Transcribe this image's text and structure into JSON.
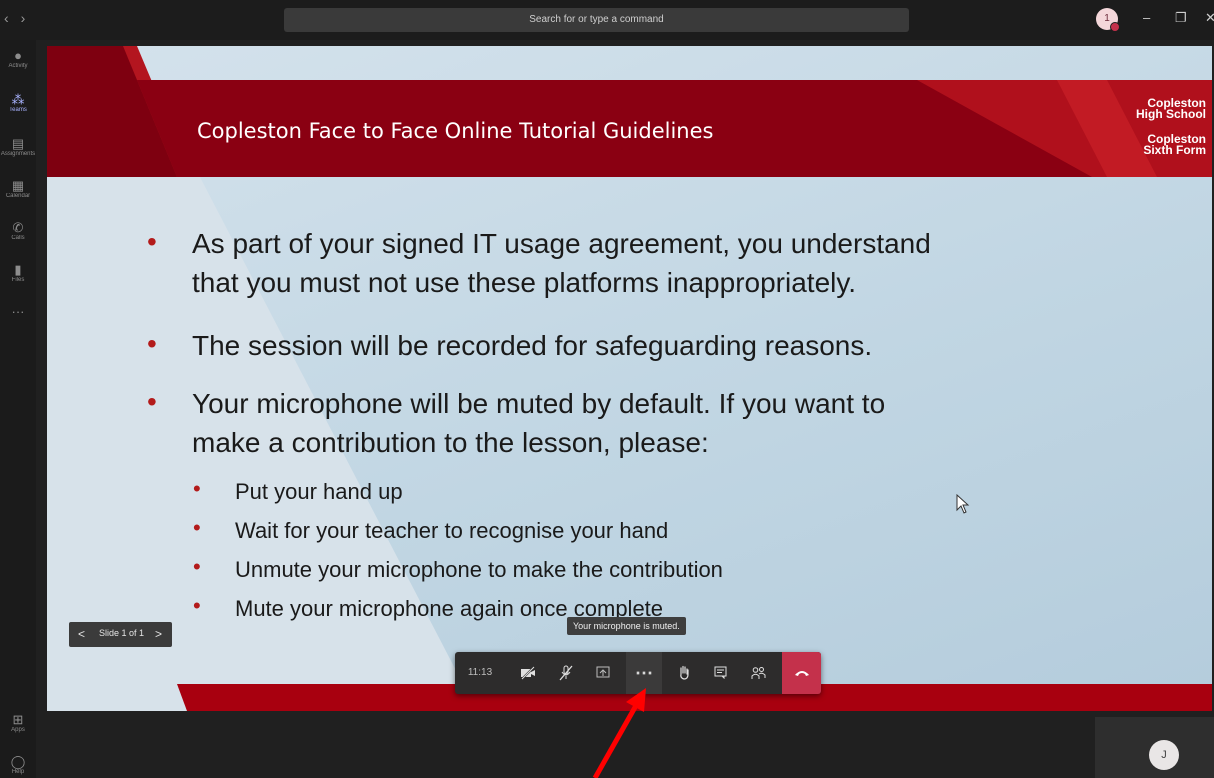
{
  "titlebar": {
    "search_placeholder": "Search for or type a command",
    "avatar_initial": "1",
    "minimize": "–",
    "maximize": "❐",
    "close": "✕",
    "back": "‹",
    "forward": "›"
  },
  "rail": {
    "items": [
      {
        "label": "Activity",
        "icon": "bell-icon",
        "glyph": "🔔"
      },
      {
        "label": "Teams",
        "icon": "teams-icon",
        "glyph": "⁂"
      },
      {
        "label": "Assignments",
        "icon": "assignments-icon",
        "glyph": "▤"
      },
      {
        "label": "Calendar",
        "icon": "calendar-icon",
        "glyph": "▦"
      },
      {
        "label": "Calls",
        "icon": "phone-icon",
        "glyph": "✆"
      },
      {
        "label": "Files",
        "icon": "file-icon",
        "glyph": "▮"
      },
      {
        "label": "",
        "icon": "more-icon",
        "glyph": "···"
      }
    ],
    "bottom": [
      {
        "label": "Apps",
        "icon": "apps-icon",
        "glyph": "⊞"
      },
      {
        "label": "Help",
        "icon": "help-icon",
        "glyph": "?"
      }
    ]
  },
  "slide": {
    "title": "Copleston Face to Face Online Tutorial Guidelines",
    "logo_line1": "Copleston",
    "logo_line2": "High School",
    "logo_line3": "Copleston",
    "logo_line4": "Sixth Form",
    "bullets": [
      "As part of your signed IT usage agreement, you understand",
      "that you must not use these platforms inappropriately.",
      "The session will be recorded for safeguarding reasons.",
      "Your microphone will be muted by default. If you want to",
      "make a contribution to the lesson, please:"
    ],
    "sub_bullets": [
      "Put your hand up",
      "Wait for your teacher to recognise your hand",
      "Unmute your microphone to make the contribution",
      "Mute your microphone again once complete"
    ]
  },
  "slide_nav": {
    "prev": "<",
    "label": "Slide 1 of 1",
    "next": ">"
  },
  "callbar": {
    "time": "11:13",
    "tooltip": "Your microphone is muted."
  },
  "self_tile": {
    "initial": "J"
  },
  "colors": {
    "teams_accent": "#a9b3ff",
    "hangup_red": "#c4314b",
    "slide_red": "#a0000f",
    "arrow_red": "#ff0000"
  }
}
